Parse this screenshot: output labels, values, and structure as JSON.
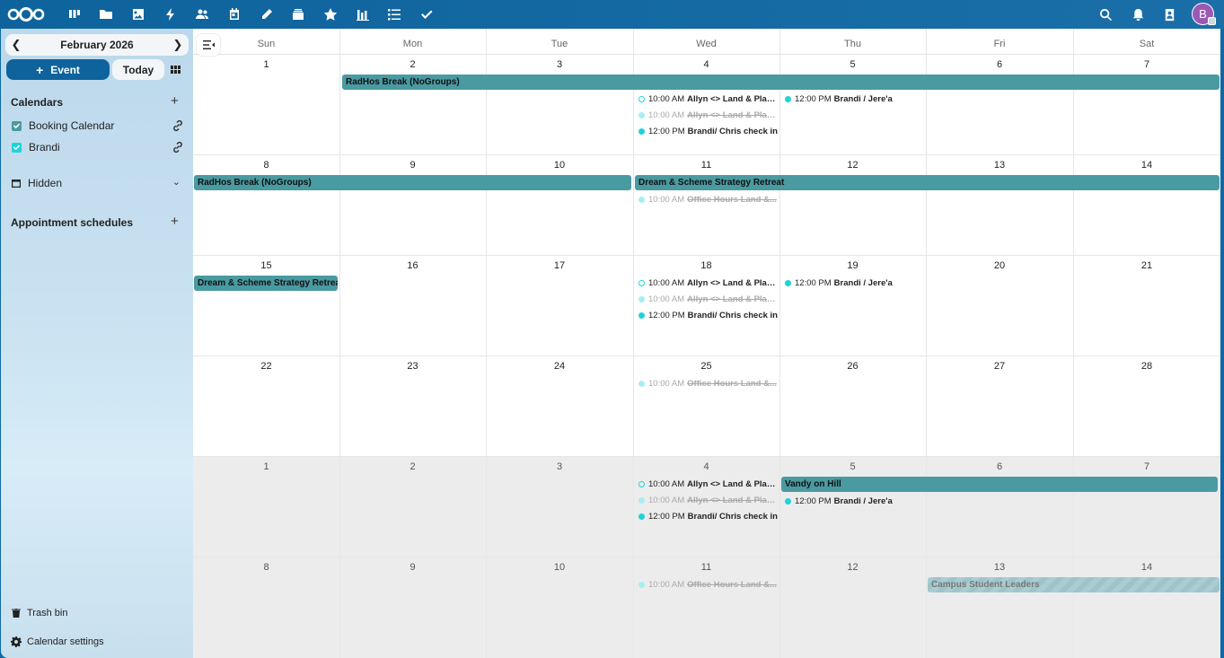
{
  "user": {
    "initial": "B"
  },
  "sidebar": {
    "month_label": "February 2026",
    "prev_icon": "chevron-left-icon",
    "next_icon": "chevron-right-icon",
    "event_button": "Event",
    "today_button": "Today",
    "calendars_title": "Calendars",
    "calendars": [
      {
        "name": "Booking Calendar",
        "color": "#4a9aa1"
      },
      {
        "name": "Brandi",
        "color": "#1dd3dc"
      }
    ],
    "hidden_label": "Hidden",
    "appointments_title": "Appointment schedules",
    "trash_label": "Trash bin",
    "settings_label": "Calendar settings"
  },
  "calendar": {
    "days_of_week": [
      "Sun",
      "Mon",
      "Tue",
      "Wed",
      "Thu",
      "Fri",
      "Sat"
    ],
    "weeks": [
      {
        "days": [
          "1",
          "2",
          "3",
          "4",
          "5",
          "6",
          "7"
        ]
      },
      {
        "days": [
          "8",
          "9",
          "10",
          "11",
          "12",
          "13",
          "14"
        ]
      },
      {
        "days": [
          "15",
          "16",
          "17",
          "18",
          "19",
          "20",
          "21"
        ]
      },
      {
        "days": [
          "22",
          "23",
          "24",
          "25",
          "26",
          "27",
          "28"
        ]
      },
      {
        "days": [
          "1",
          "2",
          "3",
          "4",
          "5",
          "6",
          "7"
        ]
      },
      {
        "days": [
          "8",
          "9",
          "10",
          "11",
          "12",
          "13",
          "14"
        ]
      }
    ],
    "allday_events": [
      {
        "title": "RadHos Break (NoGroups)"
      },
      {
        "title": "RadHos Break (NoGroups)"
      },
      {
        "title": "Dream & Scheme Strategy Retreat"
      },
      {
        "title": "Dream & Scheme Strategy Retreat"
      },
      {
        "title": "Vandy on Hill"
      },
      {
        "title": "Campus Student Leaders"
      }
    ],
    "timed_events": [
      {
        "time": "10:00 AM",
        "title": "Allyn <> Land & Plac..."
      },
      {
        "time": "10:00 AM",
        "title": "Allyn <> Land & Plac..."
      },
      {
        "time": "12:00 PM",
        "title": "Brandi/ Chris check in"
      },
      {
        "time": "12:00 PM",
        "title": "Brandi / Jere'a"
      },
      {
        "time": "10:00 AM",
        "title": "Office Hours Land &..."
      },
      {
        "time": "10:00 AM",
        "title": "Allyn <> Land & Plac..."
      },
      {
        "time": "10:00 AM",
        "title": "Allyn <> Land & Plac..."
      },
      {
        "time": "12:00 PM",
        "title": "Brandi/ Chris check in"
      },
      {
        "time": "12:00 PM",
        "title": "Brandi / Jere'a"
      },
      {
        "time": "10:00 AM",
        "title": "Office Hours Land &..."
      },
      {
        "time": "10:00 AM",
        "title": "Allyn <> Land & Plac..."
      },
      {
        "time": "10:00 AM",
        "title": "Allyn <> Land & Plac..."
      },
      {
        "time": "12:00 PM",
        "title": "Brandi/ Chris check in"
      },
      {
        "time": "12:00 PM",
        "title": "Brandi / Jere'a"
      },
      {
        "time": "10:00 AM",
        "title": "Office Hours Land &..."
      }
    ]
  }
}
